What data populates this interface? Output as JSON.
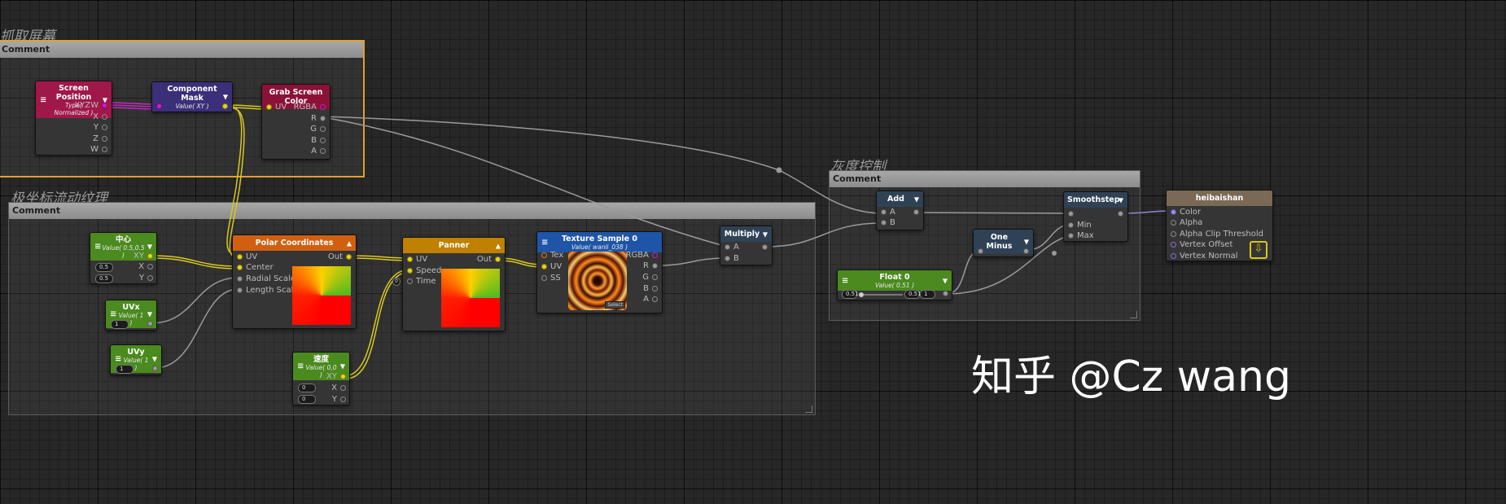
{
  "groups": {
    "grab": {
      "title": "抓取屏幕",
      "header": "Comment"
    },
    "polar": {
      "title": "极坐标流动纹理",
      "header": "Comment"
    },
    "gray": {
      "title": "灰度控制",
      "header": "Comment"
    }
  },
  "nodes": {
    "screen_position": {
      "title": "Screen Position",
      "subtitle": "Type( Normalized )",
      "outputs": [
        "XYZW",
        "X",
        "Y",
        "Z",
        "W"
      ]
    },
    "component_mask": {
      "title": "Component Mask",
      "subtitle": "Value( XY )"
    },
    "grab_screen_color": {
      "title": "Grab Screen Color",
      "input": "UV",
      "outputs": [
        "RGBA",
        "R",
        "G",
        "B",
        "A"
      ]
    },
    "center": {
      "title": "中心",
      "subtitle": "Value( 0.5,0.5 )",
      "output": "XY",
      "x_label": "X",
      "y_label": "Y",
      "x_value": "0.5",
      "y_value": "0.5"
    },
    "uvx": {
      "title": "UVx",
      "subtitle": "Value( 1 )",
      "value": "1"
    },
    "uvy": {
      "title": "UVy",
      "subtitle": "Value( 1 )",
      "value": "1"
    },
    "polar_coordinates": {
      "title": "Polar Coordinates",
      "inputs": [
        "UV",
        "Center",
        "Radial Scale",
        "Length Scale"
      ],
      "output": "Out"
    },
    "speed": {
      "title": "速度",
      "subtitle": "Value( 0,0 )",
      "output": "XY",
      "x_label": "X",
      "y_label": "Y",
      "x_value": "0",
      "y_value": "0"
    },
    "panner": {
      "title": "Panner",
      "inputs": [
        "UV",
        "Speed",
        "Time"
      ],
      "output": "Out",
      "time_value": "0"
    },
    "texture_sample": {
      "title": "Texture Sample 0",
      "subtitle": "Value( wanli_038 )",
      "inputs": [
        "Tex",
        "UV",
        "SS"
      ],
      "outputs": [
        "RGBA",
        "R",
        "G",
        "B",
        "A"
      ],
      "select_label": "Select"
    },
    "multiply": {
      "title": "Multiply",
      "inputs": [
        "A",
        "B"
      ]
    },
    "add": {
      "title": "Add",
      "inputs": [
        "A",
        "B"
      ]
    },
    "one_minus": {
      "title": "One Minus"
    },
    "smoothstep": {
      "title": "Smoothstep",
      "inputs": [
        "Min",
        "Max"
      ]
    },
    "float": {
      "title": "Float 0",
      "subtitle": "Value( 0.51 )",
      "min": "0.51",
      "value": "0.51",
      "max": "1"
    },
    "output": {
      "title": "heibaishan",
      "inputs": [
        "Color",
        "Alpha",
        "Alpha Clip Threshold",
        "Vertex Offset",
        "Vertex Normal"
      ]
    }
  },
  "watermark": "知乎 @Cz wang",
  "colors": {
    "screen_position": "#a0174a",
    "component_mask": "#3a2f78",
    "grab_screen_color": "#8a1238",
    "constant": "#4a8a1e",
    "polar": "#d06010",
    "panner": "#c08000",
    "texture": "#1f55a8",
    "math": "#2f4255",
    "output": "#7a6a55",
    "selection": "#e0a030"
  }
}
